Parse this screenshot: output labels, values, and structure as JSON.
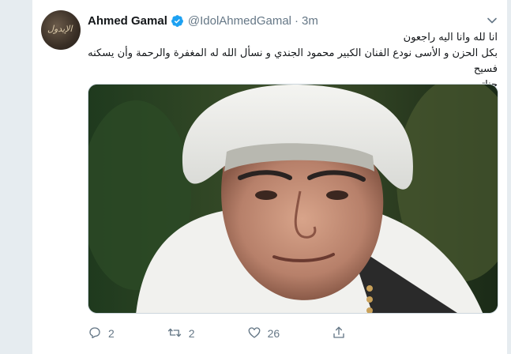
{
  "tweet": {
    "author_name": "Ahmed Gamal",
    "handle": "@IdolAhmedGamal",
    "separator": "·",
    "time": "3m",
    "text_lines": [
      "انا لله وانا اليه راجعون",
      "بكل الحزن و الأسى نودع الفنان الكبير محمود الجندي و نسأل الله له المغفرة والرحمة وأن يسكنه فسيح",
      "جناته"
    ],
    "image_alt": "Photo of an elderly man wearing a white turban"
  },
  "avatar": {
    "text": "الإيدول"
  },
  "actions": {
    "reply_count": "2",
    "retweet_count": "2",
    "like_count": "26"
  },
  "colors": {
    "verified": "#1da1f2",
    "secondary_text": "#657786",
    "primary_text": "#14171a"
  },
  "icons": {
    "verified": "verified-badge-icon",
    "chevron": "chevron-down-icon",
    "reply": "reply-icon",
    "retweet": "retweet-icon",
    "like": "like-icon",
    "share": "share-icon"
  }
}
